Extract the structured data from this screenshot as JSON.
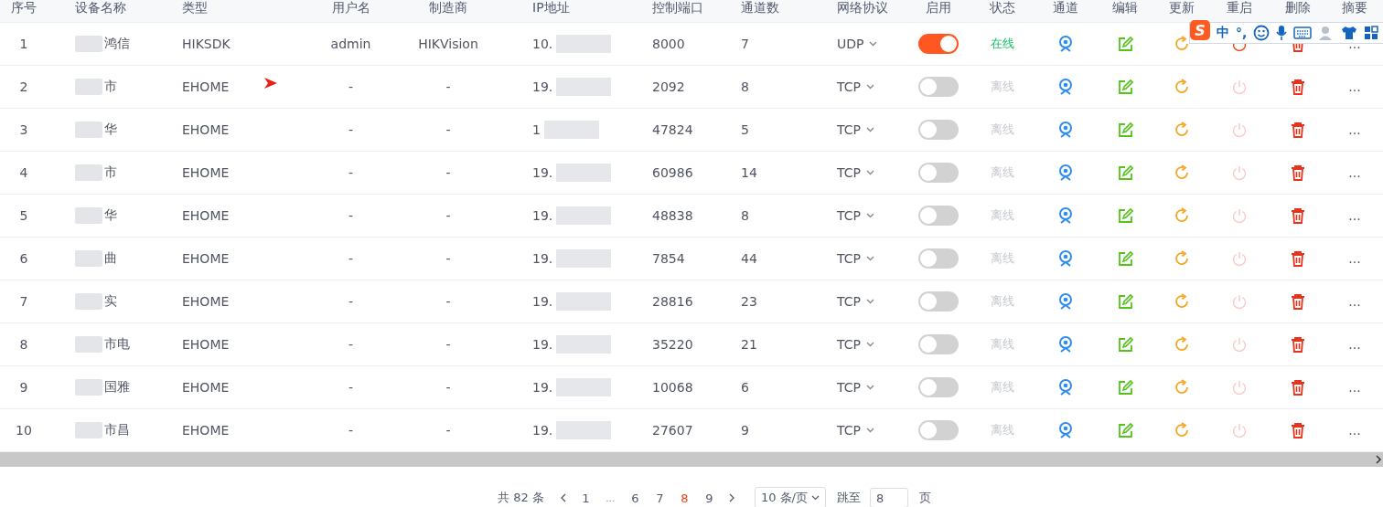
{
  "table": {
    "columns": [
      "序号",
      "设备名称",
      "类型",
      "用户名",
      "制造商",
      "IP地址",
      "控制端口",
      "通道数",
      "网络协议",
      "启用",
      "状态",
      "通道",
      "编辑",
      "更新",
      "重启",
      "删除",
      "摘要"
    ],
    "rows": [
      {
        "index": "1",
        "name": "鸿信",
        "type": "HIKSDK",
        "username": "admin",
        "maker": "HIKVision",
        "ip": "10.",
        "port": "8000",
        "channels": "7",
        "protocol": "UDP",
        "enabled": true,
        "status": "在线",
        "online": true,
        "summary": "..."
      },
      {
        "index": "2",
        "name": "市",
        "type": "EHOME",
        "username": "-",
        "maker": "-",
        "ip": "19.",
        "port": "2092",
        "channels": "8",
        "protocol": "TCP",
        "enabled": false,
        "status": "离线",
        "online": false,
        "summary": "..."
      },
      {
        "index": "3",
        "name": "华",
        "type": "EHOME",
        "username": "-",
        "maker": "-",
        "ip": "1",
        "port": "47824",
        "channels": "5",
        "protocol": "TCP",
        "enabled": false,
        "status": "离线",
        "online": false,
        "summary": "..."
      },
      {
        "index": "4",
        "name": "市",
        "type": "EHOME",
        "username": "-",
        "maker": "-",
        "ip": "19.",
        "port": "60986",
        "channels": "14",
        "protocol": "TCP",
        "enabled": false,
        "status": "离线",
        "online": false,
        "summary": "..."
      },
      {
        "index": "5",
        "name": "华",
        "type": "EHOME",
        "username": "-",
        "maker": "-",
        "ip": "19.",
        "port": "48838",
        "channels": "8",
        "protocol": "TCP",
        "enabled": false,
        "status": "离线",
        "online": false,
        "summary": "..."
      },
      {
        "index": "6",
        "name": "曲",
        "type": "EHOME",
        "username": "-",
        "maker": "-",
        "ip": "19.",
        "port": "7854",
        "channels": "44",
        "protocol": "TCP",
        "enabled": false,
        "status": "离线",
        "online": false,
        "summary": "..."
      },
      {
        "index": "7",
        "name": "实",
        "type": "EHOME",
        "username": "-",
        "maker": "-",
        "ip": "19.",
        "port": "28816",
        "channels": "23",
        "protocol": "TCP",
        "enabled": false,
        "status": "离线",
        "online": false,
        "summary": "..."
      },
      {
        "index": "8",
        "name": "市电",
        "type": "EHOME",
        "username": "-",
        "maker": "-",
        "ip": "19.",
        "port": "35220",
        "channels": "21",
        "protocol": "TCP",
        "enabled": false,
        "status": "离线",
        "online": false,
        "summary": "..."
      },
      {
        "index": "9",
        "name": "国雅",
        "type": "EHOME",
        "username": "-",
        "maker": "-",
        "ip": "19.",
        "port": "10068",
        "channels": "6",
        "protocol": "TCP",
        "enabled": false,
        "status": "离线",
        "online": false,
        "summary": "..."
      },
      {
        "index": "10",
        "name": "市昌",
        "type": "EHOME",
        "username": "-",
        "maker": "-",
        "ip": "19.",
        "port": "27607",
        "channels": "9",
        "protocol": "TCP",
        "enabled": false,
        "status": "离线",
        "online": false,
        "summary": "..."
      }
    ]
  },
  "ime": {
    "logo": "S",
    "mode": "中",
    "punctuation": "°,"
  },
  "pagination": {
    "total": "共 82 条",
    "pages": [
      {
        "label": "1",
        "kind": "page",
        "selected": false
      },
      {
        "label": "...",
        "kind": "ellipsis",
        "selected": false
      },
      {
        "label": "6",
        "kind": "page",
        "selected": false
      },
      {
        "label": "7",
        "kind": "page",
        "selected": false
      },
      {
        "label": "8",
        "kind": "page",
        "selected": true
      },
      {
        "label": "9",
        "kind": "page",
        "selected": false
      }
    ],
    "page_size": "10 条/页",
    "jump_label": "跳至",
    "jump_value": "8",
    "jump_suffix": "页"
  }
}
